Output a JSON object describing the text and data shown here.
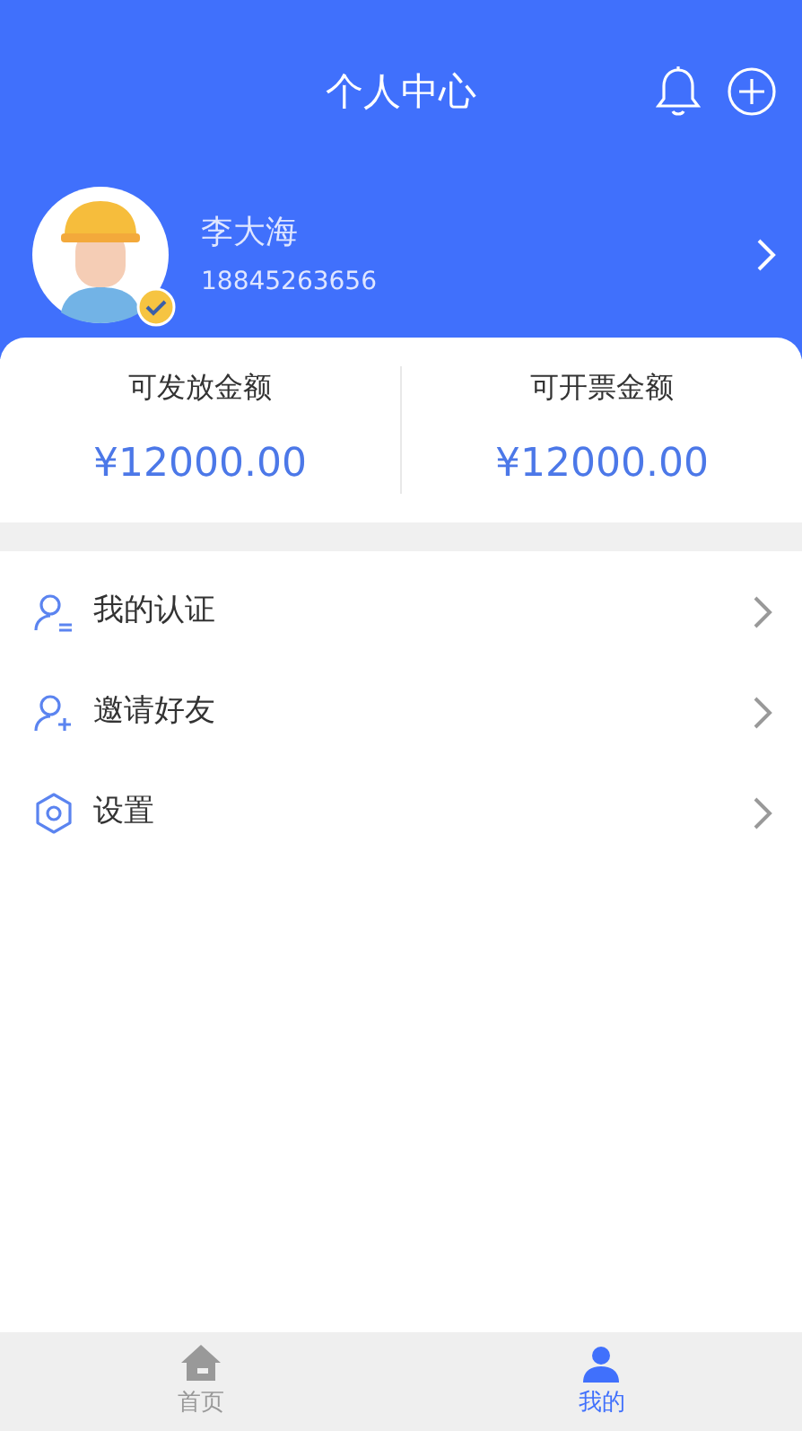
{
  "header": {
    "title": "个人中心"
  },
  "profile": {
    "name": "李大海",
    "phone": "18845263656",
    "verified": true
  },
  "balances": [
    {
      "label": "可发放金额",
      "amount": "¥12000.00"
    },
    {
      "label": "可开票金额",
      "amount": "¥12000.00"
    }
  ],
  "menu": [
    {
      "kind": "certification",
      "label": "我的认证"
    },
    {
      "kind": "invite",
      "label": "邀请好友"
    },
    {
      "kind": "settings",
      "label": "设置"
    }
  ],
  "tab_bar": [
    {
      "kind": "home",
      "label": "首页",
      "selected": false
    },
    {
      "kind": "profile",
      "label": "我的",
      "selected": true
    }
  ]
}
